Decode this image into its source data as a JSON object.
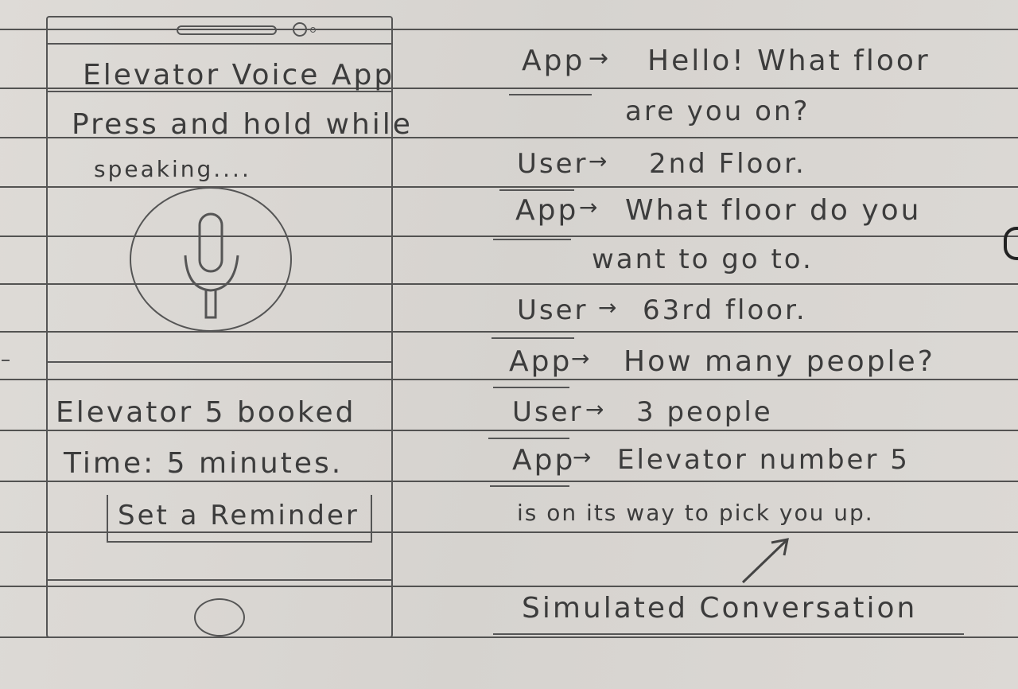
{
  "phone": {
    "title": "Elevator Voice App",
    "instruction_line1": "Press and hold while",
    "instruction_line2": "speaking....",
    "mic_icon": "microphone-icon",
    "booking_line1": "Elevator 5 booked",
    "booking_line2": "Time: 5 minutes.",
    "reminder_button": "Set a Reminder"
  },
  "conversation": {
    "lines": [
      {
        "speaker": "App",
        "text": "Hello! What floor"
      },
      {
        "speaker": "",
        "text": "are you on?"
      },
      {
        "speaker": "User",
        "text": "2nd Floor."
      },
      {
        "speaker": "App",
        "text": "What floor do you"
      },
      {
        "speaker": "",
        "text": "want to go to."
      },
      {
        "speaker": "User",
        "text": "63rd floor."
      },
      {
        "speaker": "App",
        "text": "How many people?"
      },
      {
        "speaker": "User",
        "text": "3 people"
      },
      {
        "speaker": "App",
        "text": "Elevator number 5"
      },
      {
        "speaker": "",
        "text": "is on its way to pick you up."
      }
    ],
    "caption": "Simulated Conversation"
  }
}
